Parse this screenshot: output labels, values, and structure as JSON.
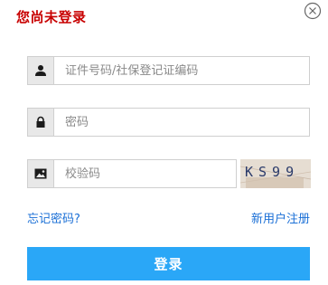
{
  "dialog": {
    "title": "您尚未登录",
    "close_icon": "close-circle-icon"
  },
  "form": {
    "id_field": {
      "icon": "user-icon",
      "placeholder": "证件号码/社保登记证编码",
      "value": ""
    },
    "password_field": {
      "icon": "lock-icon",
      "placeholder": "密码",
      "value": ""
    },
    "captcha_field": {
      "icon": "image-icon",
      "placeholder": "校验码",
      "value": ""
    },
    "captcha_image_text": "KS99"
  },
  "links": {
    "forgot_password": "忘记密码?",
    "register": "新用户注册"
  },
  "login_button": "登录",
  "colors": {
    "title": "#c80000",
    "link": "#1a6fd6",
    "button": "#2aa7f7"
  }
}
